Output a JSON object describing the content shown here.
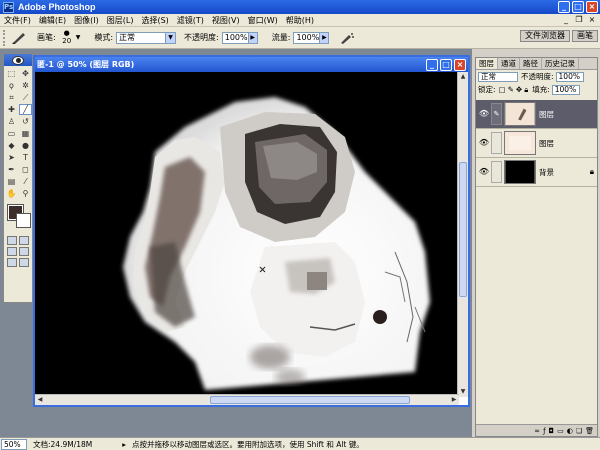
{
  "app": {
    "title": "Adobe Photoshop"
  },
  "menu": [
    "文件(F)",
    "编辑(E)",
    "图像(I)",
    "图层(L)",
    "选择(S)",
    "滤镜(T)",
    "视图(V)",
    "窗口(W)",
    "帮助(H)"
  ],
  "options": {
    "brush_label": "画笔:",
    "brush_size": "20",
    "mode_label": "模式:",
    "mode_value": "正常",
    "opacity_label": "不透明度:",
    "opacity_value": "100%",
    "flow_label": "流量:",
    "flow_value": "100%"
  },
  "palette_well": {
    "tab1": "文件浏览器",
    "tab2": "画笔"
  },
  "document": {
    "title": "匿-1 @ 50% (图层    RGB)"
  },
  "layers_panel": {
    "tabs": [
      "图层",
      "通道",
      "路径",
      "历史记录"
    ],
    "blend_mode": "正常",
    "opacity_label": "不透明度:",
    "opacity_value": "100%",
    "lock_label": "锁定:",
    "fill_label": "填充:",
    "fill_value": "100%",
    "layers": [
      {
        "name": "图层",
        "selected": true
      },
      {
        "name": "图层",
        "selected": false
      },
      {
        "name": "背景",
        "selected": false
      }
    ]
  },
  "status": {
    "zoom": "50%",
    "doc_info": "文档:24.9M/18M",
    "message": "点按并拖移以移动图层或选区。要用附加选项，使用 Shift 和 Alt 键。"
  }
}
